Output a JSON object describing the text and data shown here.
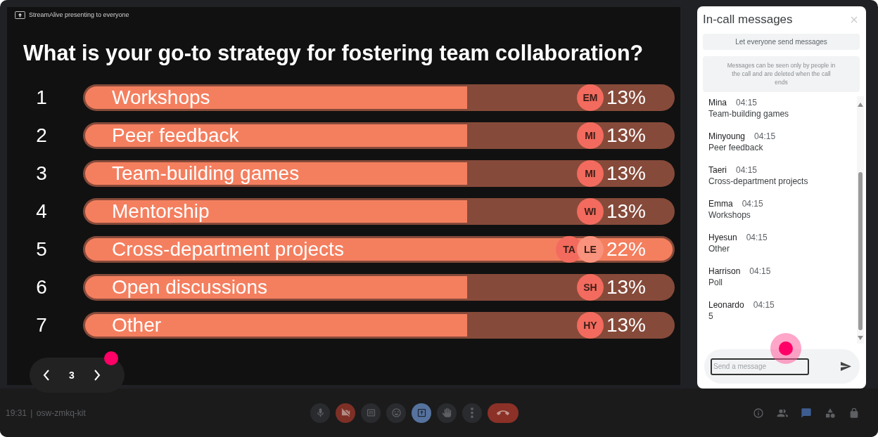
{
  "presentation": {
    "presenter_label": "StreamAlive presenting to everyone",
    "question": "What is your go-to strategy for fostering team collaboration?",
    "options": [
      {
        "number": "1",
        "label": "Workshops",
        "level": 0.65,
        "voters": [
          {
            "initials": "EM",
            "color": "#f26b5e"
          }
        ],
        "percent": "13%"
      },
      {
        "number": "2",
        "label": "Peer feedback",
        "level": 0.65,
        "voters": [
          {
            "initials": "MI",
            "color": "#f26b5e"
          }
        ],
        "percent": "13%"
      },
      {
        "number": "3",
        "label": "Team-building games",
        "level": 0.65,
        "voters": [
          {
            "initials": "MI",
            "color": "#f26b5e"
          }
        ],
        "percent": "13%"
      },
      {
        "number": "4",
        "label": "Mentorship",
        "level": 0.65,
        "voters": [
          {
            "initials": "WI",
            "color": "#f26b5e"
          }
        ],
        "percent": "13%"
      },
      {
        "number": "5",
        "label": "Cross-department projects",
        "level": 1,
        "voters": [
          {
            "initials": "TA",
            "color": "#f26b5e"
          },
          {
            "initials": "LE",
            "color": "#f9937e"
          }
        ],
        "percent": "22%"
      },
      {
        "number": "6",
        "label": "Open discussions",
        "level": 0.65,
        "voters": [
          {
            "initials": "SH",
            "color": "#f26b5e"
          }
        ],
        "percent": "13%"
      },
      {
        "number": "7",
        "label": "Other",
        "level": 0.65,
        "voters": [
          {
            "initials": "HY",
            "color": "#f26b5e"
          }
        ],
        "percent": "13%"
      }
    ],
    "slide_nav": {
      "page": "3"
    }
  },
  "chat": {
    "title": "In-call messages",
    "permission_button": "Let everyone send messages",
    "notice": "Messages can be seen only by people in the call and are deleted when the call ends",
    "messages": [
      {
        "sender": "Mina",
        "time": "04:15",
        "text": "Team-building games"
      },
      {
        "sender": "Minyoung",
        "time": "04:15",
        "text": "Peer feedback"
      },
      {
        "sender": "Taeri",
        "time": "04:15",
        "text": "Cross-department projects"
      },
      {
        "sender": "Emma",
        "time": "04:15",
        "text": "Workshops"
      },
      {
        "sender": "Hyesun",
        "time": "04:15",
        "text": "Other"
      },
      {
        "sender": "Harrison",
        "time": "04:15",
        "text": "Poll"
      },
      {
        "sender": "Leonardo",
        "time": "04:15",
        "text": "5"
      }
    ],
    "input": {
      "placeholder": "Send a message"
    }
  },
  "bottom_bar": {
    "meeting_info": "19:31 | osw-zmkq-kit",
    "center_controls": [
      {
        "kind": "mic",
        "selected": false
      },
      {
        "kind": "camera-off",
        "selected": false
      },
      {
        "kind": "captions",
        "selected": false
      },
      {
        "kind": "emoji",
        "selected": false
      },
      {
        "kind": "present",
        "selected": true
      },
      {
        "kind": "hand",
        "selected": false
      },
      {
        "kind": "more",
        "selected": false
      },
      {
        "kind": "end-call",
        "selected": false
      }
    ],
    "right_controls": [
      {
        "kind": "info",
        "selected": false
      },
      {
        "kind": "people",
        "selected": false
      },
      {
        "kind": "chat",
        "selected": true
      },
      {
        "kind": "activities",
        "selected": false
      },
      {
        "kind": "host-controls",
        "selected": false
      }
    ]
  }
}
